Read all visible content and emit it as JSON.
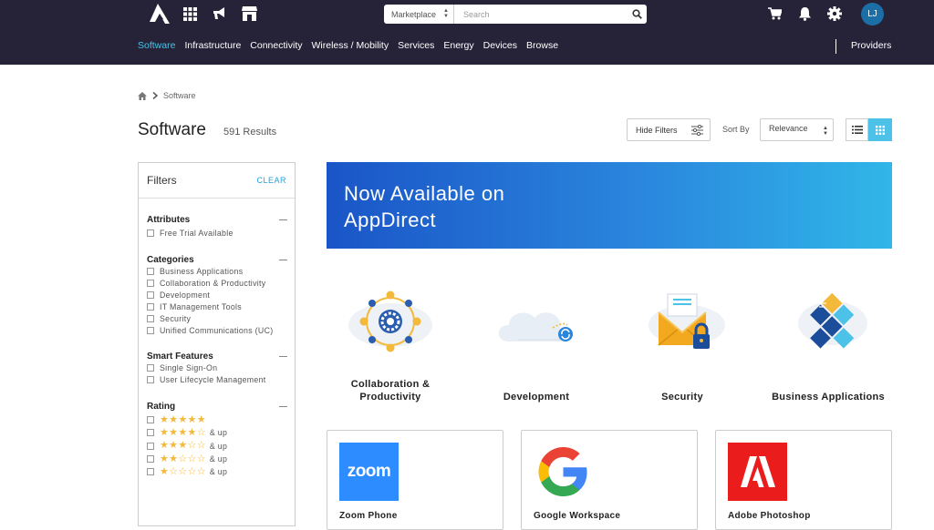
{
  "header": {
    "search": {
      "scope": "Marketplace",
      "placeholder": "Search"
    },
    "avatar_initials": "LJ",
    "nav": [
      {
        "label": "Software",
        "active": true
      },
      {
        "label": "Infrastructure"
      },
      {
        "label": "Connectivity"
      },
      {
        "label": "Wireless / Mobility"
      },
      {
        "label": "Services"
      },
      {
        "label": "Energy"
      },
      {
        "label": "Devices"
      },
      {
        "label": "Browse"
      }
    ],
    "providers_label": "Providers",
    "icons": [
      "logo-icon",
      "grid-apps-icon",
      "megaphone-icon",
      "store-icon",
      "cart-icon",
      "bell-icon",
      "gear-icon"
    ]
  },
  "breadcrumb": {
    "current": "Software"
  },
  "page": {
    "title": "Software",
    "results": "591 Results"
  },
  "toolbar": {
    "hide_filters": "Hide Filters",
    "sort_by": "Sort By",
    "sort_value": "Relevance"
  },
  "filters": {
    "title": "Filters",
    "clear": "CLEAR",
    "attributes": {
      "title": "Attributes",
      "options": [
        "Free Trial Available"
      ]
    },
    "categories": {
      "title": "Categories",
      "options": [
        "Business Applications",
        "Collaboration & Productivity",
        "Development",
        "IT Management Tools",
        "Security",
        "Unified Communications (UC)"
      ]
    },
    "smart_features": {
      "title": "Smart Features",
      "options": [
        "Single Sign-On",
        "User Lifecycle Management"
      ]
    },
    "rating": {
      "title": "Rating",
      "and_up": "& up",
      "levels": [
        5,
        4,
        3,
        2,
        1
      ]
    }
  },
  "banner": {
    "title": "Now Available on AppDirect"
  },
  "categories": [
    {
      "label": "Collaboration & Productivity"
    },
    {
      "label": "Development"
    },
    {
      "label": "Security"
    },
    {
      "label": "Business Applications"
    }
  ],
  "products": [
    {
      "name": "Zoom Phone",
      "logo_text": "zoom"
    },
    {
      "name": "Google Workspace"
    },
    {
      "name": "Adobe Photoshop"
    }
  ],
  "colors": {
    "header_bg": "#262338",
    "accent": "#4cc2e8",
    "link": "#2a9fd6",
    "star": "#f2b93b"
  }
}
